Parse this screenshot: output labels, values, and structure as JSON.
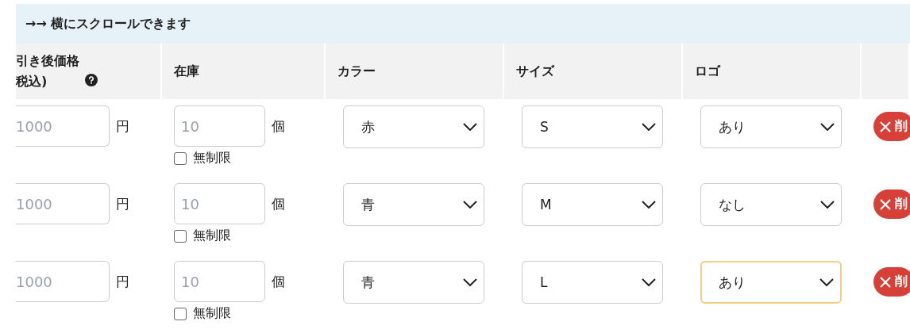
{
  "notice": "→→ 横にスクロールできます",
  "columns": [
    {
      "label": "引き後価格税込)",
      "kind": "help"
    },
    {
      "label": "在庫",
      "kind": "plain"
    },
    {
      "label": "カラー",
      "kind": "plain"
    },
    {
      "label": "サイズ",
      "kind": "plain"
    },
    {
      "label": "ロゴ",
      "kind": "plain"
    }
  ],
  "rows": [
    {
      "price": {
        "placeholder": "1000",
        "unit": "円"
      },
      "stock": {
        "placeholder": "10",
        "unit": "個",
        "unlimited_label": "無制限",
        "unlimited": false
      },
      "selects": [
        {
          "value": "赤",
          "focused": false
        },
        {
          "value": "S",
          "focused": false
        },
        {
          "value": "あり",
          "focused": false
        }
      ],
      "delete_label": "削"
    },
    {
      "price": {
        "placeholder": "1000",
        "unit": "円"
      },
      "stock": {
        "placeholder": "10",
        "unit": "個",
        "unlimited_label": "無制限",
        "unlimited": false
      },
      "selects": [
        {
          "value": "青",
          "focused": false
        },
        {
          "value": "M",
          "focused": false
        },
        {
          "value": "なし",
          "focused": false
        }
      ],
      "delete_label": "削"
    },
    {
      "price": {
        "placeholder": "1000",
        "unit": "円"
      },
      "stock": {
        "placeholder": "10",
        "unit": "個",
        "unlimited_label": "無制限",
        "unlimited": false
      },
      "selects": [
        {
          "value": "青",
          "focused": false
        },
        {
          "value": "L",
          "focused": false
        },
        {
          "value": "あり",
          "focused": true
        }
      ],
      "delete_label": "削"
    }
  ]
}
